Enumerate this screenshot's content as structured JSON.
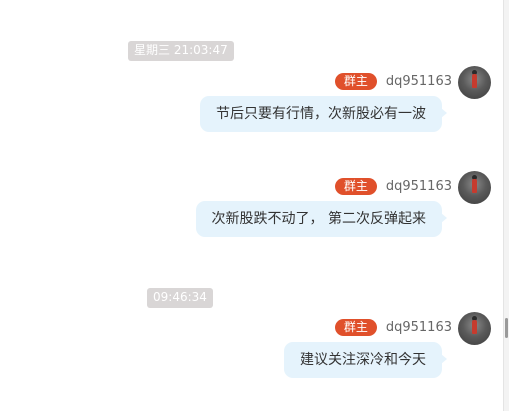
{
  "timestamps": [
    "星期三 21:03:47",
    "09:46:34"
  ],
  "messages": [
    {
      "badge": "群主",
      "username": "dq951163",
      "text": "节后只要有行情，次新股必有一波",
      "avatar_icon": "user-avatar-icon"
    },
    {
      "badge": "群主",
      "username": "dq951163",
      "text": "次新股跌不动了， 第二次反弹起来",
      "avatar_icon": "user-avatar-icon"
    },
    {
      "badge": "群主",
      "username": "dq951163",
      "text": "建议关注深冷和今天",
      "avatar_icon": "user-avatar-icon"
    }
  ],
  "colors": {
    "badge_bg": "#e0502b",
    "bubble_bg": "#e5f3fc",
    "timestamp_bg": "#d9d6d6"
  }
}
